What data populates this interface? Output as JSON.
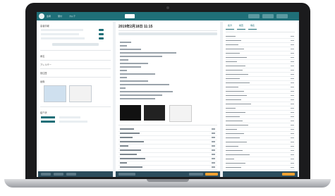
{
  "header": {
    "date": "2019年2月18日 11:15",
    "user_label": "患者",
    "nav_1": "受付",
    "nav_2": "カルテ"
  },
  "colors": {
    "accent": "#1f6f78",
    "footer": "#2b4c5c",
    "highlight": "#f0a030"
  },
  "left": {
    "section_1": "患者情報",
    "section_2": "病名",
    "section_3": "アレルギー",
    "section_4": "既往歴",
    "section_5": "画像",
    "section_6": "紹介状"
  },
  "right": {
    "tab_1": "処方",
    "tab_2": "検査",
    "tab_3": "病名"
  }
}
